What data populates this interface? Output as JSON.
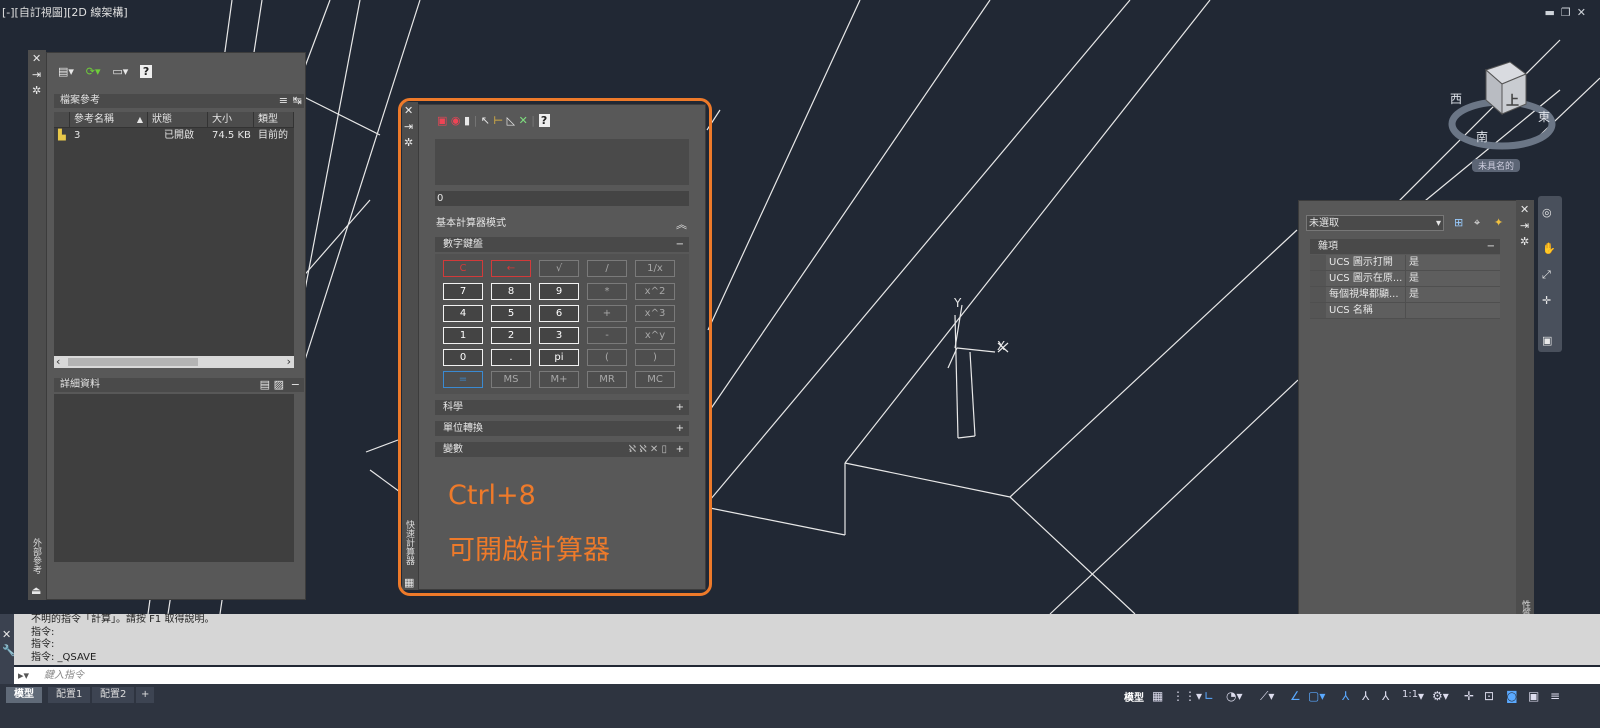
{
  "viewport_label": "[-][自訂視圖][2D 線架構]",
  "window_controls": [
    "▬",
    "❐",
    "✕"
  ],
  "xref": {
    "toolbar_icons": [
      "attach-dwg-icon",
      "refresh-icon",
      "change-path-icon",
      "help-icon"
    ],
    "help_glyph": "?",
    "title": "檔案參考",
    "columns": [
      "參考名稱",
      "狀態",
      "大小",
      "類型"
    ],
    "rows": [
      {
        "name": "3",
        "status": "已開啟",
        "size": "74.5 KB",
        "type": "目前的"
      }
    ],
    "details_title": "詳細資料",
    "side_label": "外部參考"
  },
  "calculator": {
    "toolbar_icons": [
      "clear-icon",
      "clear-history-icon",
      "paste-icon",
      "get-coordinates-icon",
      "distance-icon",
      "angle-icon",
      "intersection-icon",
      "help-icon"
    ],
    "help_glyph": "?",
    "input_value": "0",
    "mode_label": "基本計算器模式",
    "numpad_title": "數字鍵盤",
    "keys": [
      "C",
      "←",
      "√",
      "/",
      "1/x",
      "7",
      "8",
      "9",
      "*",
      "x^2",
      "4",
      "5",
      "6",
      "+",
      "x^3",
      "1",
      "2",
      "3",
      "-",
      "x^y",
      "0",
      ".",
      "pi",
      "(",
      ")",
      "=",
      "MS",
      "M+",
      "MR",
      "MC"
    ],
    "sections": [
      "科學",
      "單位轉換",
      "變數"
    ],
    "side_label": "快速計算器"
  },
  "annotation": {
    "line1": "Ctrl+8",
    "line2": "可開啟計算器"
  },
  "viewcube": {
    "top": "上",
    "west": "西",
    "east": "東",
    "south": "南",
    "ucs_label": "未具名的"
  },
  "properties": {
    "selection": "未選取",
    "category": "雜項",
    "rows": [
      {
        "name": "UCS 圖示打開",
        "value": "是"
      },
      {
        "name": "UCS 圖示在原...",
        "value": "是"
      },
      {
        "name": "每個視埠都顯...",
        "value": "是"
      },
      {
        "name": "UCS 名稱",
        "value": ""
      }
    ],
    "side_label": "性質"
  },
  "axes": {
    "y": "Y",
    "x": "X"
  },
  "command": {
    "history": [
      "不明的指令「計算」。請按 F1 取得說明。",
      "指令:",
      "指令:",
      "指令: _QSAVE"
    ],
    "placeholder": "鍵入指令"
  },
  "layout_tabs": [
    "模型",
    "配置1",
    "配置2",
    "+"
  ],
  "status_bar": {
    "model_label": "模型",
    "scale": "1:1"
  },
  "accent_color": "#ee7a2a"
}
